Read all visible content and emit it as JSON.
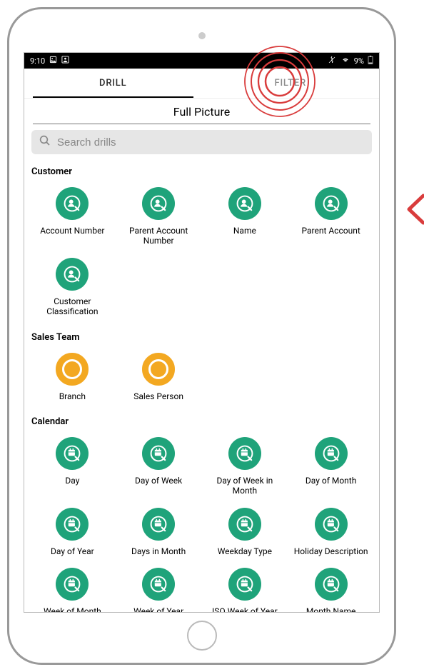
{
  "status_bar": {
    "time": "9:10",
    "battery": "9%"
  },
  "tabs": {
    "drill": "DRILL",
    "filter": "FILTER"
  },
  "page_title": "Full Picture",
  "search": {
    "placeholder": "Search drills"
  },
  "sections": [
    {
      "key": "customer",
      "title": "Customer",
      "icon_type": "person",
      "color": "green",
      "items": [
        {
          "label": "Account Number"
        },
        {
          "label": "Parent Account Number"
        },
        {
          "label": "Name"
        },
        {
          "label": "Parent Account"
        },
        {
          "label": "Customer Classification"
        }
      ]
    },
    {
      "key": "sales_team",
      "title": "Sales Team",
      "icon_type": "ring",
      "color": "orange",
      "items": [
        {
          "label": "Branch"
        },
        {
          "label": "Sales Person"
        }
      ]
    },
    {
      "key": "calendar",
      "title": "Calendar",
      "icon_type": "calendar",
      "color": "green",
      "items": [
        {
          "label": "Day"
        },
        {
          "label": "Day of Week"
        },
        {
          "label": "Day of Week in Month"
        },
        {
          "label": "Day of Month"
        },
        {
          "label": "Day of Year"
        },
        {
          "label": "Days in Month"
        },
        {
          "label": "Weekday Type"
        },
        {
          "label": "Holiday Description"
        },
        {
          "label": "Week of Month"
        },
        {
          "label": "Week of Year"
        },
        {
          "label": "ISO Week of Year"
        },
        {
          "label": "Month Name"
        }
      ]
    }
  ]
}
